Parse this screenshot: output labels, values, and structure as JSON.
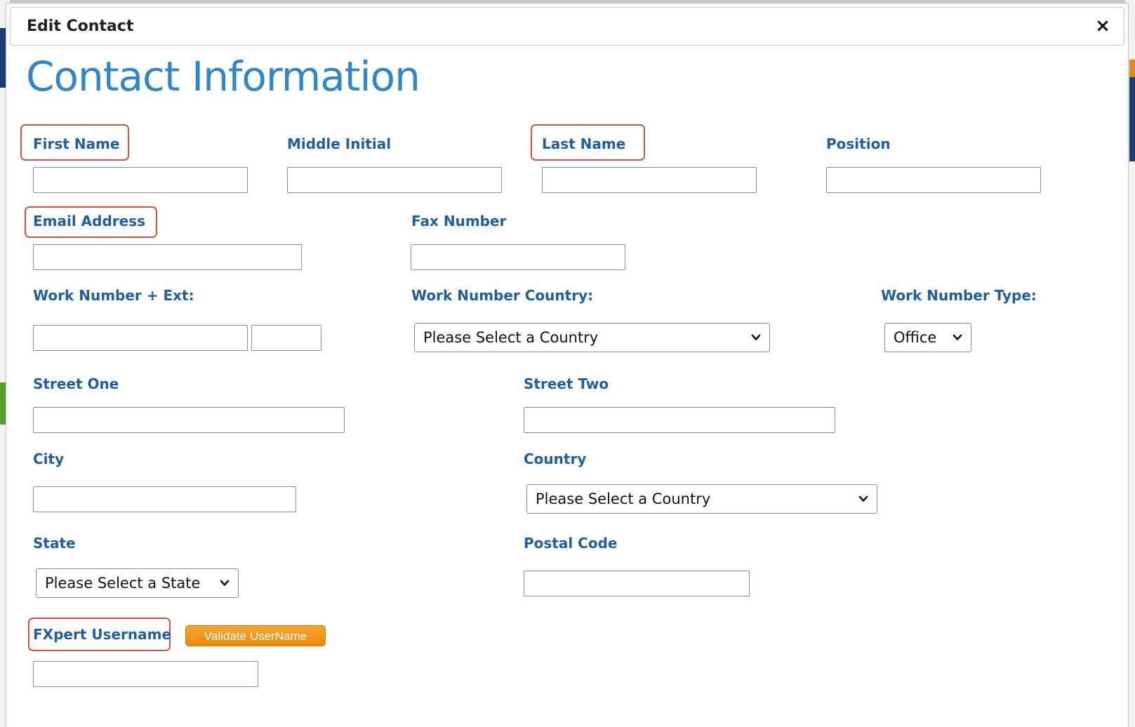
{
  "dialog": {
    "title": "Edit Contact",
    "close_glyph": "×",
    "heading": "Contact Information"
  },
  "fields": {
    "first_name": {
      "label": "First Name",
      "value": ""
    },
    "middle_initial": {
      "label": "Middle Initial",
      "value": ""
    },
    "last_name": {
      "label": "Last Name",
      "value": ""
    },
    "position": {
      "label": "Position",
      "value": ""
    },
    "email": {
      "label": "Email Address",
      "value": ""
    },
    "fax": {
      "label": "Fax Number",
      "value": ""
    },
    "work_number": {
      "label": "Work Number + Ext:",
      "value": "",
      "ext_value": ""
    },
    "work_country": {
      "label": "Work Number Country:",
      "selected": "Please Select a Country"
    },
    "work_type": {
      "label": "Work Number Type:",
      "selected": "Office"
    },
    "street_one": {
      "label": "Street One",
      "value": ""
    },
    "street_two": {
      "label": "Street Two",
      "value": ""
    },
    "city": {
      "label": "City",
      "value": ""
    },
    "country": {
      "label": "Country",
      "selected": "Please Select a Country"
    },
    "state": {
      "label": "State",
      "selected": "Please Select a State"
    },
    "postal_code": {
      "label": "Postal Code",
      "value": ""
    },
    "fxpert_username": {
      "label": "FXpert Username",
      "value": ""
    }
  },
  "buttons": {
    "validate_username": "Validate UserName"
  },
  "icons": {
    "close": "close-icon",
    "dropdown": "chevron-down-icon"
  },
  "colors": {
    "label": "#1f5fa0",
    "heading": "#2f86c9",
    "highlight": "#d9503f",
    "button": "#ec8a0f"
  }
}
